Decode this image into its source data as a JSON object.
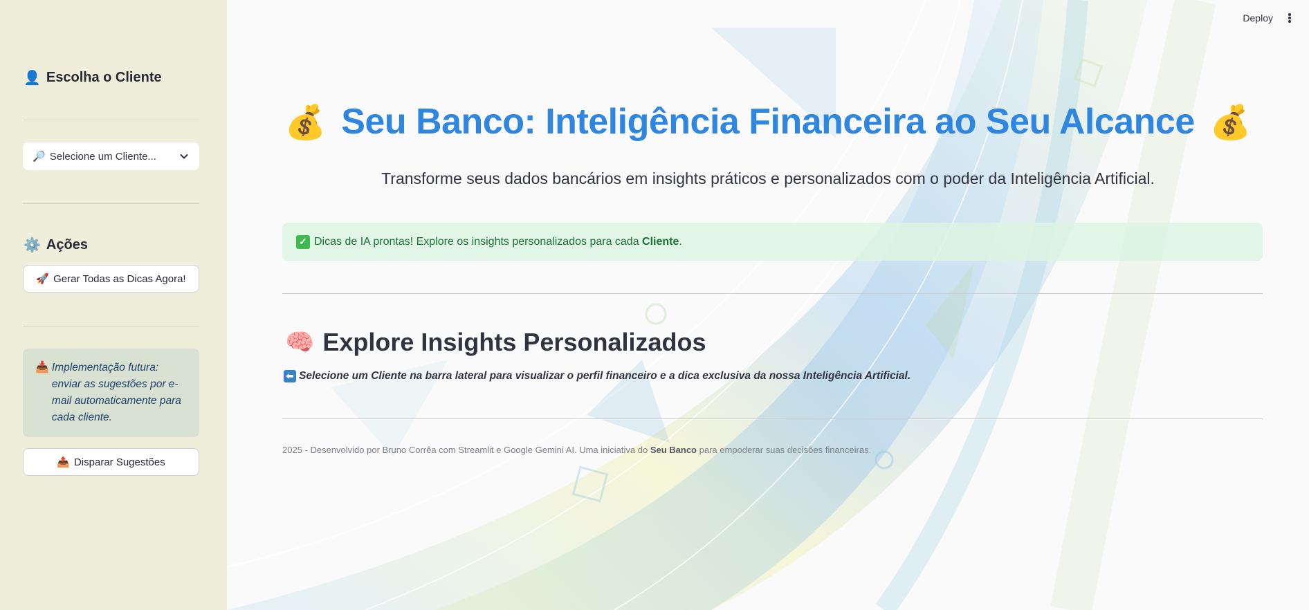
{
  "sidebar": {
    "client_heading": "Escolha o Cliente",
    "client_heading_icon": "person-icon",
    "select": {
      "value": "Selecione um Cliente...",
      "icon": "magnifier-icon"
    },
    "actions_heading": "Ações",
    "actions_heading_icon": "gear-icon",
    "generate_button": "Gerar Todas as Dicas Agora!",
    "generate_button_icon": "rocket-icon",
    "info_text": "Implementação futura: enviar as sugestões por e-mail automaticamente para cada cliente.",
    "info_icon": "inbox-icon",
    "send_button": "Disparar Sugestões",
    "send_button_icon": "outbox-tray-icon"
  },
  "header": {
    "deploy": "Deploy"
  },
  "main": {
    "title": "Seu Banco: Inteligência Financeira ao Seu Alcance",
    "title_emoji": "💰",
    "subtitle": "Transforme seus dados bancários em insights práticos e personalizados com o poder da Inteligência Artificial.",
    "success_text": "Dicas de IA prontas! Explore os insights personalizados para cada ",
    "success_bold": "Cliente",
    "success_end": ".",
    "section_title": "Explore Insights Personalizados",
    "section_emoji": "🧠",
    "hint_text": "Selecione um Cliente na barra lateral para visualizar o perfil financeiro e a dica exclusiva da nossa Inteligência Artificial.",
    "footer_prefix": "2025 - Desenvolvido por Bruno Corrêa com Streamlit e Google Gemini AI. Uma iniciativa do ",
    "footer_bold": "Seu Banco",
    "footer_suffix": " para empoderar suas decisões financeiras."
  },
  "colors": {
    "sidebar_bg": "#efeedb",
    "title": "#2e86e0",
    "success_bg": "#dcf4e2",
    "success_text": "#177233",
    "info_bg": "#d8e1d2"
  }
}
